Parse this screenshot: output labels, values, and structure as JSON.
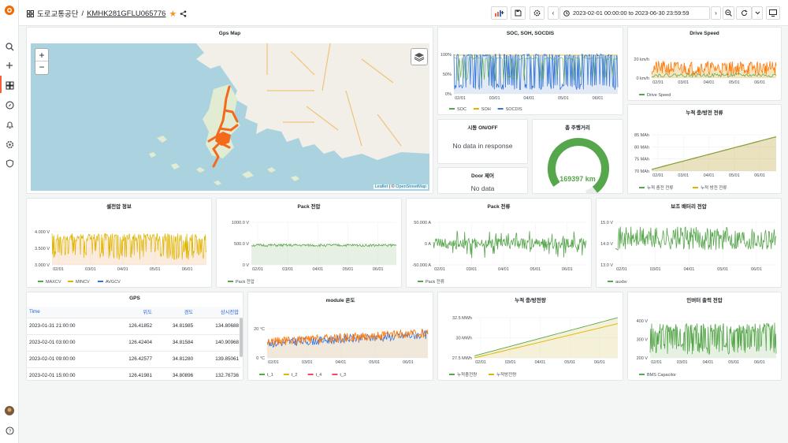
{
  "topbar": {
    "folder": "도로교통공단",
    "sep": "/",
    "dashboard": "KMHK281GFLU065776",
    "time_range": "2023-02-01 00:00:00 to 2023-06-30 23:59:59"
  },
  "colors": {
    "green": "#56a64b",
    "yellow": "#e0b400",
    "blue": "#3274d9",
    "orange": "#ff780a",
    "red": "#f2495c"
  },
  "map": {
    "title": "Gps Map",
    "zoom_in": "+",
    "zoom_out": "−",
    "attribution_a": "Leaflet",
    "attribution_sep": " | © ",
    "attribution_b": "OpenStreetMap"
  },
  "soc": {
    "title": "SOC, SOH, SOCDIS",
    "yticks": [
      "100%",
      "50%",
      "0%"
    ],
    "xticks": [
      "02/01",
      "03/01",
      "04/01",
      "05/01",
      "06/01"
    ],
    "legend": [
      "SOC",
      "SOH",
      "SOCDIS"
    ]
  },
  "speed": {
    "title": "Drive Speed",
    "yticks": [
      "20 km/h",
      "0 km/h"
    ],
    "xticks": [
      "02/01",
      "03/01",
      "04/01",
      "05/01",
      "06/01"
    ],
    "legend": [
      "Drive Speed"
    ]
  },
  "onoff": {
    "title": "시동 ON/OFF",
    "message": "No data in response"
  },
  "door": {
    "title": "Door 제어",
    "message": "No data"
  },
  "distance": {
    "title": "총 주행거리",
    "value": "169397 km",
    "fraction": 0.93
  },
  "charge": {
    "title": "누적 충/방전 전류",
    "yticks": [
      "85 MAh",
      "80 MAh",
      "75 MAh",
      "70 MAh"
    ],
    "xticks": [
      "02/01",
      "03/01",
      "04/01",
      "05/01",
      "06/01"
    ],
    "legend": [
      "누적 충전 전류",
      "누적 방전 전류"
    ]
  },
  "cell": {
    "title": "셀전압 정보",
    "yticks": [
      "4.000 V",
      "3.500 V",
      "3.000 V"
    ],
    "xticks": [
      "02/01",
      "03/01",
      "04/01",
      "05/01",
      "06/01"
    ],
    "legend": [
      "MAXCV",
      "MINCV",
      "AVGCV"
    ]
  },
  "packv": {
    "title": "Pack 전압",
    "yticks": [
      "1000.0 V",
      "500.0 V",
      "0 V"
    ],
    "xticks": [
      "02/01",
      "03/01",
      "04/01",
      "05/01",
      "06/01"
    ],
    "legend": [
      "Pack 전압"
    ]
  },
  "packa": {
    "title": "Pack 전류",
    "yticks": [
      "50.000 A",
      "0 A",
      "-50.000 A"
    ],
    "xticks": [
      "02/01",
      "03/01",
      "04/01",
      "05/01",
      "06/01"
    ],
    "legend": [
      "Pack 전류"
    ]
  },
  "aux": {
    "title": "보조 배터리 전압",
    "yticks": [
      "15.0 V",
      "14.0 V",
      "13.0 V"
    ],
    "xticks": [
      "02/01",
      "03/01",
      "04/01",
      "05/01",
      "06/01"
    ],
    "legend": [
      "auxbv"
    ]
  },
  "gps": {
    "title": "GPS",
    "headers": [
      "Time",
      "위도",
      "경도",
      "상시전압"
    ],
    "rows": [
      [
        "2023-01-31 21:00:00",
        "126.41852",
        "34.81985",
        "134.80688"
      ],
      [
        "2023-02-01 03:00:00",
        "126.42404",
        "34.81584",
        "140.90968"
      ],
      [
        "2023-02-01 09:00:00",
        "126.42577",
        "34.81280",
        "139.85061"
      ],
      [
        "2023-02-01 15:00:00",
        "126.41981",
        "34.80896",
        "132.76736"
      ],
      [
        "2023-02-01 21:00:00",
        "126.42577",
        "34.81277",
        "137.85843"
      ]
    ]
  },
  "module": {
    "title": "module 온도",
    "yticks": [
      "20 °C",
      "0 °C"
    ],
    "xticks": [
      "02/01",
      "03/01",
      "04/01",
      "05/01",
      "06/01"
    ],
    "legend": [
      "t_1",
      "t_2",
      "t_4",
      "t_3"
    ]
  },
  "energy": {
    "title": "누적 충/방전량",
    "yticks": [
      "32.5 MWh",
      "30 MWh",
      "27.5 MWh"
    ],
    "xticks": [
      "02/01",
      "03/01",
      "04/01",
      "05/01",
      "06/01"
    ],
    "legend": [
      "누적충전량",
      "누적방전량"
    ]
  },
  "inverter": {
    "title": "인버터 출력 전압",
    "yticks": [
      "400 V",
      "300 V",
      "200 V"
    ],
    "xticks": [
      "02/01",
      "03/01",
      "04/01",
      "05/01",
      "06/01"
    ],
    "legend": [
      "BMS Capacitor"
    ]
  }
}
